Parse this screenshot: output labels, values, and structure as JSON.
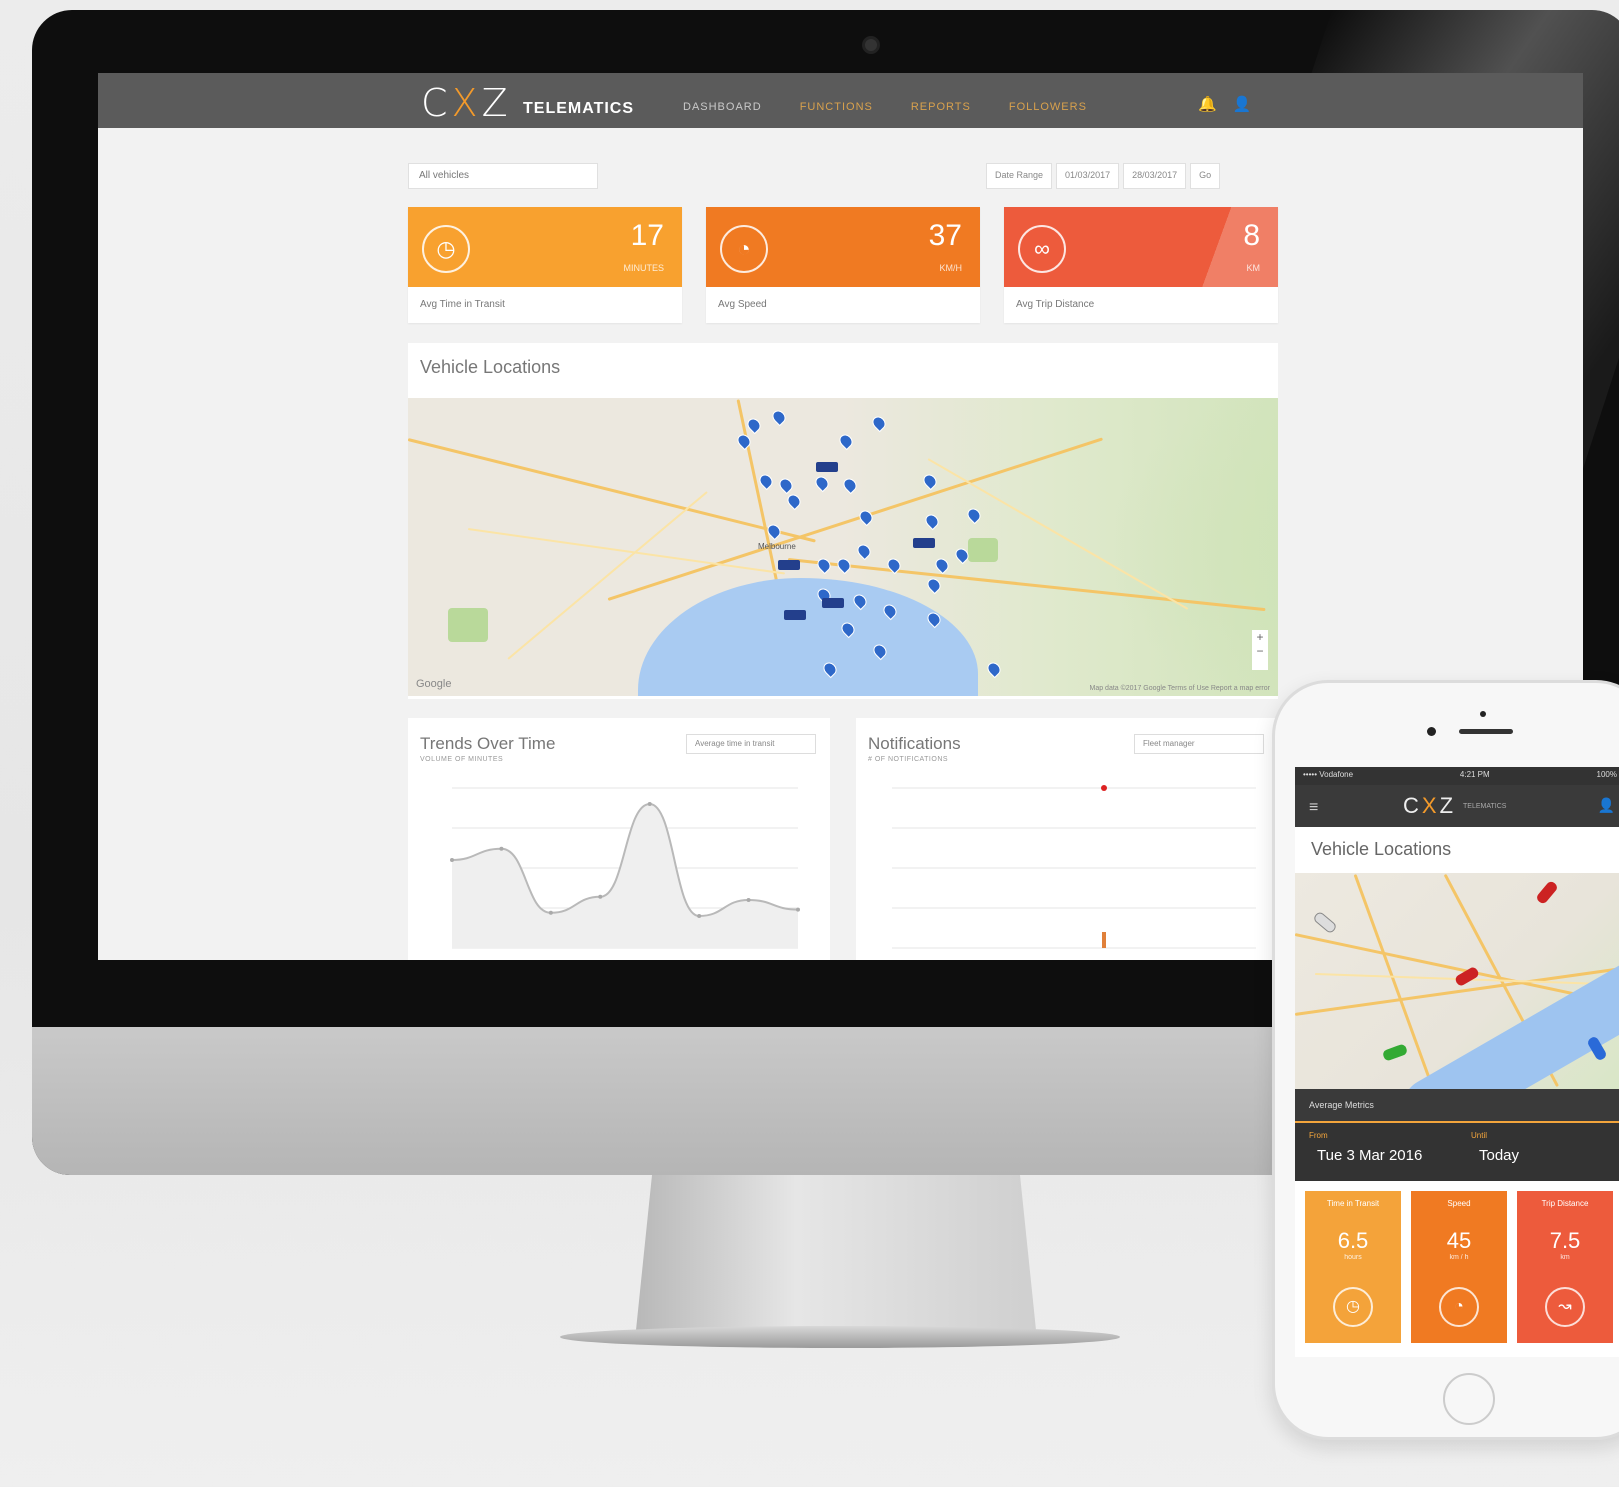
{
  "desktop": {
    "brand": {
      "logo_c": "C",
      "logo_x": "X",
      "logo_z": "Z",
      "sub": "TELEMATICS"
    },
    "nav": [
      "DASHBOARD",
      "FUNCTIONS",
      "REPORTS",
      "FOLLOWERS"
    ],
    "vehicle_select": "All vehicles",
    "date_controls": [
      "Date Range",
      "01/03/2017",
      "28/03/2017",
      "Go"
    ],
    "kpis": [
      {
        "value": "17",
        "unit": "MINUTES",
        "label": "Avg Time in Transit",
        "color": "#f8a12f",
        "icon": "clock-icon"
      },
      {
        "value": "37",
        "unit": "KM/H",
        "label": "Avg Speed",
        "color": "#f07a22",
        "icon": "speedometer-icon"
      },
      {
        "value": "8",
        "unit": "KM",
        "label": "Avg Trip Distance",
        "color": "#ed5b3c",
        "icon": "route-icon"
      }
    ],
    "map": {
      "title": "Vehicle Locations",
      "city": "Melbourne",
      "google": "Google",
      "attribution": "Map data ©2017 Google  Terms of Use  Report a map error"
    },
    "trends": {
      "title": "Trends Over Time",
      "subtitle": "VOLUME OF MINUTES",
      "select": "Average time in transit"
    },
    "notifications": {
      "title": "Notifications",
      "subtitle": "# OF NOTIFICATIONS",
      "select": "Fleet manager"
    }
  },
  "phone": {
    "status_left": "••••• Vodafone",
    "status_center": "4:21 PM",
    "status_right": "100%",
    "brand": {
      "logo_c": "C",
      "logo_x": "X",
      "logo_z": "Z",
      "sub": "TELEMATICS"
    },
    "title": "Vehicle Locations",
    "metrics_bar": "Average Metrics",
    "from_label": "From",
    "from_value": "Tue 3 Mar 2016",
    "to_label": "Until",
    "to_value": "Today",
    "tiles": [
      {
        "label": "Time in Transit",
        "value": "6.5",
        "unit": "hours",
        "color": "#f4a33a",
        "icon": "clock-icon"
      },
      {
        "label": "Speed",
        "value": "45",
        "unit": "km / h",
        "color": "#f07a22",
        "icon": "speedometer-icon"
      },
      {
        "label": "Trip Distance",
        "value": "7.5",
        "unit": "km",
        "color": "#ed5b3c",
        "icon": "route-icon"
      }
    ]
  },
  "chart_data": [
    {
      "type": "line",
      "title": "Trends Over Time",
      "ylabel": "VOLUME OF MINUTES",
      "x": [
        0,
        1,
        2,
        3,
        4,
        5,
        6,
        7
      ],
      "series": [
        {
          "values": [
            55,
            62,
            22,
            32,
            90,
            20,
            30,
            24
          ]
        }
      ],
      "ylim": [
        0,
        100
      ],
      "grid": true
    },
    {
      "type": "scatter",
      "title": "Notifications",
      "ylabel": "# OF NOTIFICATIONS",
      "x": [
        4
      ],
      "series": [
        {
          "values": [
            20
          ]
        }
      ],
      "ylim": [
        0,
        20
      ],
      "grid": true
    }
  ]
}
